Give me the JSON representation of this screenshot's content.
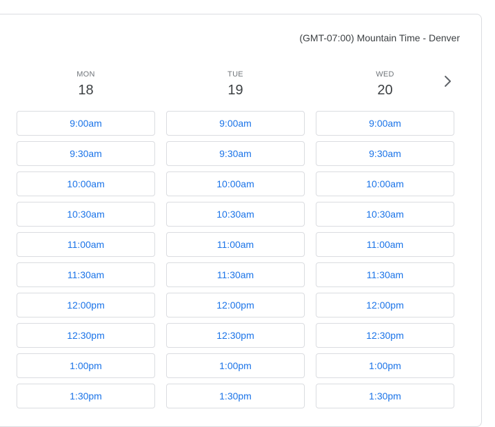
{
  "timezone": "(GMT-07:00) Mountain Time - Denver",
  "days": [
    {
      "name": "MON",
      "date": "18",
      "slots": [
        "9:00am",
        "9:30am",
        "10:00am",
        "10:30am",
        "11:00am",
        "11:30am",
        "12:00pm",
        "12:30pm",
        "1:00pm",
        "1:30pm"
      ]
    },
    {
      "name": "TUE",
      "date": "19",
      "slots": [
        "9:00am",
        "9:30am",
        "10:00am",
        "10:30am",
        "11:00am",
        "11:30am",
        "12:00pm",
        "12:30pm",
        "1:00pm",
        "1:30pm"
      ]
    },
    {
      "name": "WED",
      "date": "20",
      "slots": [
        "9:00am",
        "9:30am",
        "10:00am",
        "10:30am",
        "11:00am",
        "11:30am",
        "12:00pm",
        "12:30pm",
        "1:00pm",
        "1:30pm"
      ]
    }
  ],
  "icons": {
    "next": "chevron-right-icon"
  },
  "colors": {
    "slot_text": "#1a73e8",
    "slot_border": "#dadce0",
    "header_text": "#3c4043"
  }
}
